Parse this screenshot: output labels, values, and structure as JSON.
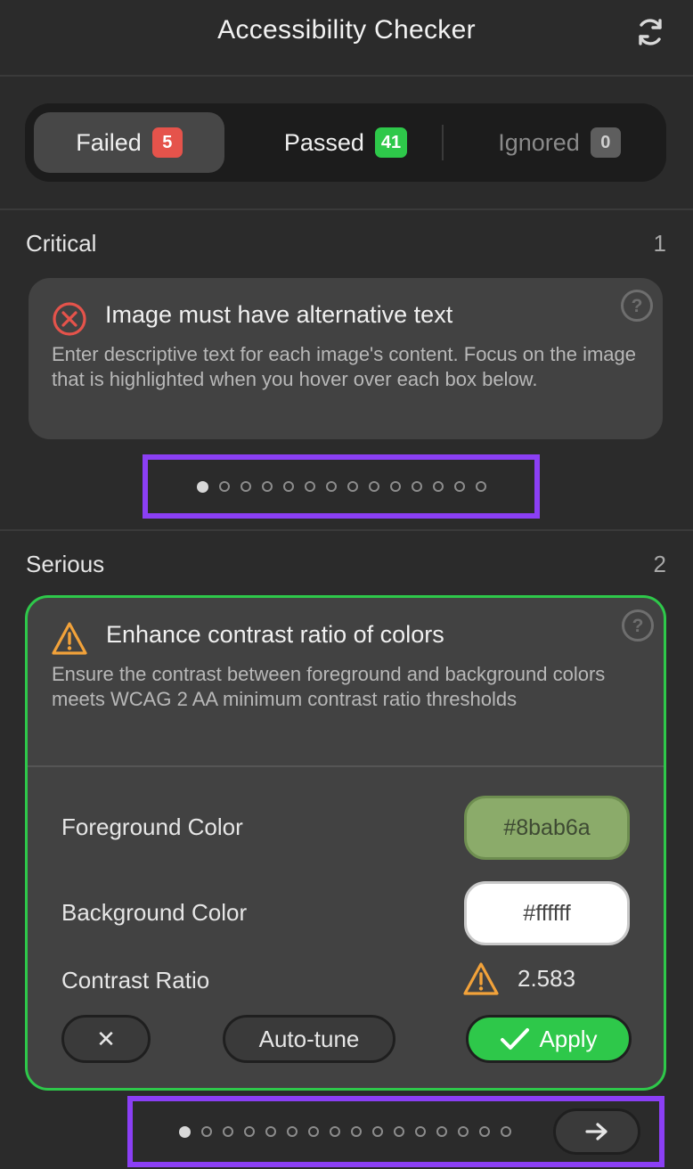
{
  "header": {
    "title": "Accessibility Checker",
    "refresh_icon": "refresh-icon"
  },
  "tabs": [
    {
      "label": "Failed",
      "count": "5",
      "active": true
    },
    {
      "label": "Passed",
      "count": "41",
      "active": false
    },
    {
      "label": "Ignored",
      "count": "0",
      "active": false
    }
  ],
  "critical": {
    "title": "Critical",
    "count": "1",
    "issue": {
      "icon": "error-circle-icon",
      "title": "Image must have alternative text",
      "description": "Enter descriptive text for each image's content. Focus on the image that is highlighted when you hover over each box below."
    },
    "pagination": {
      "total": 14,
      "current": 1
    }
  },
  "serious": {
    "title": "Serious",
    "count": "2",
    "issue": {
      "icon": "warning-triangle-icon",
      "title": "Enhance contrast ratio of colors",
      "description": "Ensure the contrast between foreground and background colors meets WCAG 2 AA minimum contrast ratio thresholds",
      "foreground_label": "Foreground Color",
      "foreground_value": "#8bab6a",
      "background_label": "Background Color",
      "background_value": "#ffffff",
      "ratio_label": "Contrast Ratio",
      "ratio_value": "2.583",
      "buttons": {
        "dismiss": "✕",
        "autotune": "Auto-tune",
        "apply": "Apply"
      }
    },
    "pagination": {
      "total": 16,
      "current": 1
    }
  },
  "colors": {
    "failed_badge": "#e5534b",
    "passed_badge": "#2ec84a",
    "highlight_border": "#8b3ff5",
    "selected_card_border": "#2ec84a"
  }
}
